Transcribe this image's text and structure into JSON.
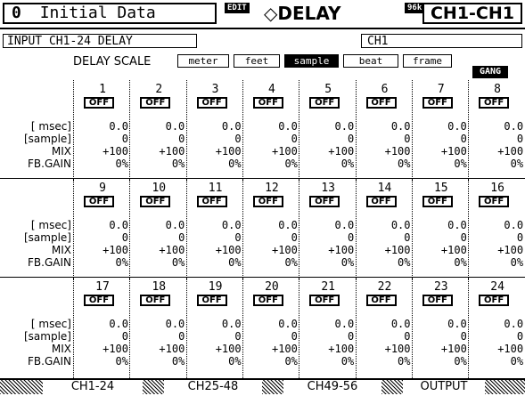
{
  "header": {
    "scene_number": "0",
    "scene_title": "Initial Data",
    "edit_badge": "EDIT",
    "function_name": "◇DELAY",
    "fs_badge": "96k",
    "channel_range": "CH1-CH1"
  },
  "subheader": {
    "section_label": "INPUT CH1-24 DELAY",
    "channel_name": "CH1"
  },
  "delay_scale": {
    "label": "DELAY SCALE",
    "options": [
      {
        "label": "meter",
        "selected": false
      },
      {
        "label": "feet",
        "selected": false
      },
      {
        "label": "sample",
        "selected": true
      },
      {
        "label": "beat",
        "selected": false
      },
      {
        "label": "frame",
        "selected": false
      }
    ]
  },
  "gang_label": "GANG",
  "row_labels": [
    "[ msec]",
    "[sample]",
    "MIX",
    "FB.GAIN"
  ],
  "channels": [
    {
      "num": "1",
      "state": "OFF",
      "msec": "0.0",
      "sample": "0",
      "mix": "+100",
      "fb": "0%"
    },
    {
      "num": "2",
      "state": "OFF",
      "msec": "0.0",
      "sample": "0",
      "mix": "+100",
      "fb": "0%"
    },
    {
      "num": "3",
      "state": "OFF",
      "msec": "0.0",
      "sample": "0",
      "mix": "+100",
      "fb": "0%"
    },
    {
      "num": "4",
      "state": "OFF",
      "msec": "0.0",
      "sample": "0",
      "mix": "+100",
      "fb": "0%"
    },
    {
      "num": "5",
      "state": "OFF",
      "msec": "0.0",
      "sample": "0",
      "mix": "+100",
      "fb": "0%"
    },
    {
      "num": "6",
      "state": "OFF",
      "msec": "0.0",
      "sample": "0",
      "mix": "+100",
      "fb": "0%"
    },
    {
      "num": "7",
      "state": "OFF",
      "msec": "0.0",
      "sample": "0",
      "mix": "+100",
      "fb": "0%"
    },
    {
      "num": "8",
      "state": "OFF",
      "msec": "0.0",
      "sample": "0",
      "mix": "+100",
      "fb": "0%"
    },
    {
      "num": "9",
      "state": "OFF",
      "msec": "0.0",
      "sample": "0",
      "mix": "+100",
      "fb": "0%"
    },
    {
      "num": "10",
      "state": "OFF",
      "msec": "0.0",
      "sample": "0",
      "mix": "+100",
      "fb": "0%"
    },
    {
      "num": "11",
      "state": "OFF",
      "msec": "0.0",
      "sample": "0",
      "mix": "+100",
      "fb": "0%"
    },
    {
      "num": "12",
      "state": "OFF",
      "msec": "0.0",
      "sample": "0",
      "mix": "+100",
      "fb": "0%"
    },
    {
      "num": "13",
      "state": "OFF",
      "msec": "0.0",
      "sample": "0",
      "mix": "+100",
      "fb": "0%"
    },
    {
      "num": "14",
      "state": "OFF",
      "msec": "0.0",
      "sample": "0",
      "mix": "+100",
      "fb": "0%"
    },
    {
      "num": "15",
      "state": "OFF",
      "msec": "0.0",
      "sample": "0",
      "mix": "+100",
      "fb": "0%"
    },
    {
      "num": "16",
      "state": "OFF",
      "msec": "0.0",
      "sample": "0",
      "mix": "+100",
      "fb": "0%"
    },
    {
      "num": "17",
      "state": "OFF",
      "msec": "0.0",
      "sample": "0",
      "mix": "+100",
      "fb": "0%"
    },
    {
      "num": "18",
      "state": "OFF",
      "msec": "0.0",
      "sample": "0",
      "mix": "+100",
      "fb": "0%"
    },
    {
      "num": "19",
      "state": "OFF",
      "msec": "0.0",
      "sample": "0",
      "mix": "+100",
      "fb": "0%"
    },
    {
      "num": "20",
      "state": "OFF",
      "msec": "0.0",
      "sample": "0",
      "mix": "+100",
      "fb": "0%"
    },
    {
      "num": "21",
      "state": "OFF",
      "msec": "0.0",
      "sample": "0",
      "mix": "+100",
      "fb": "0%"
    },
    {
      "num": "22",
      "state": "OFF",
      "msec": "0.0",
      "sample": "0",
      "mix": "+100",
      "fb": "0%"
    },
    {
      "num": "23",
      "state": "OFF",
      "msec": "0.0",
      "sample": "0",
      "mix": "+100",
      "fb": "0%"
    },
    {
      "num": "24",
      "state": "OFF",
      "msec": "0.0",
      "sample": "0",
      "mix": "+100",
      "fb": "0%"
    }
  ],
  "tabs": [
    {
      "label": "CH1-24",
      "active": true
    },
    {
      "label": "CH25-48",
      "active": false
    },
    {
      "label": "CH49-56",
      "active": false
    },
    {
      "label": "OUTPUT",
      "active": false
    }
  ]
}
